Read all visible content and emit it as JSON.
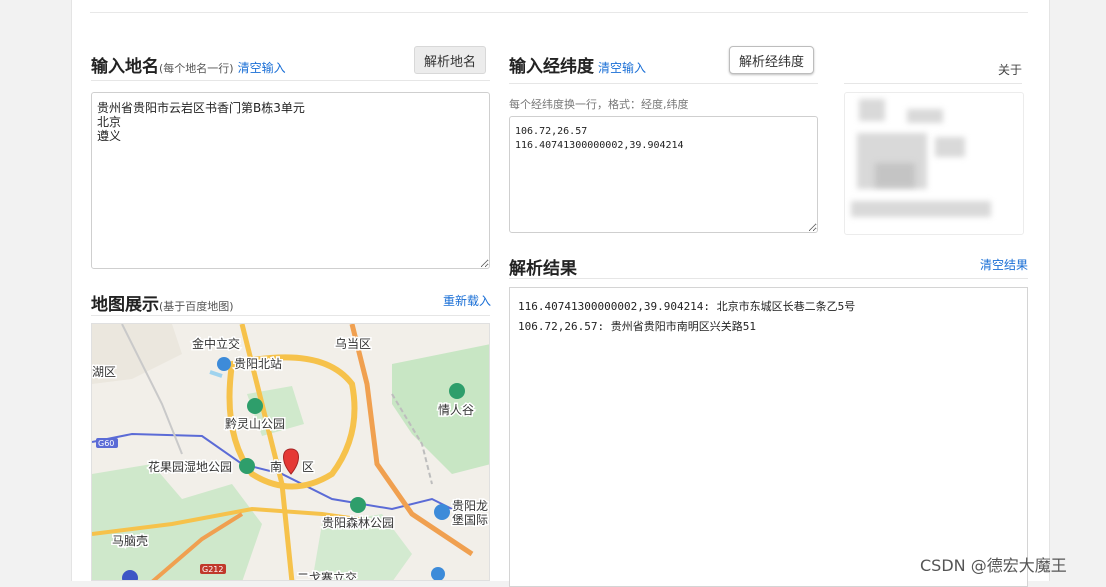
{
  "names_section": {
    "title": "输入地名",
    "subtitle": "(每个地名一行)",
    "clear_link": "清空输入",
    "parse_button": "解析地名",
    "input_value": "贵州省贵阳市云岩区书香门第B栋3单元\n北京\n遵义"
  },
  "coords_section": {
    "title": "输入经纬度",
    "clear_link": "清空输入",
    "parse_button": "解析经纬度",
    "hint": "每个经纬度换一行，格式：经度,纬度",
    "input_value": "106.72,26.57\n116.40741300000002,39.904214"
  },
  "about": {
    "label": "关于"
  },
  "results_section": {
    "title": "解析结果",
    "clear_link": "清空结果",
    "lines": [
      "116.40741300000002,39.904214: 北京市东城区长巷二条乙5号",
      "106.72,26.57: 贵州省贵阳市南明区兴关路51"
    ]
  },
  "map_section": {
    "title": "地图展示",
    "subtitle": "(基于百度地图)",
    "reload_link": "重新载入",
    "labels": {
      "jinzhong": "金中立交",
      "wudang": "乌当区",
      "north_station": "贵阳北站",
      "hu_district": "湖区",
      "qingren_valley": "情人谷",
      "qianling_park": "黔灵山公园",
      "g60": "G60",
      "huaguoyuan_park": "花果园湿地公园",
      "nanming_a": "南",
      "nanming_b": "区",
      "guiyang_long_a": "贵阳龙",
      "guiyang_long_b": "堡国际",
      "forest_park": "贵阳森林公园",
      "manao": "马脑壳",
      "g212": "G212",
      "ergezhai": "二戈寨立交"
    },
    "colors": {
      "water": "#9fd3ee",
      "park": "#c8e6c4",
      "road_major": "#f6c24b",
      "highway": "#f0a050",
      "base": "#f2efe9",
      "pin": "#e53935"
    }
  },
  "watermark": "CSDN @德宏大魔王"
}
